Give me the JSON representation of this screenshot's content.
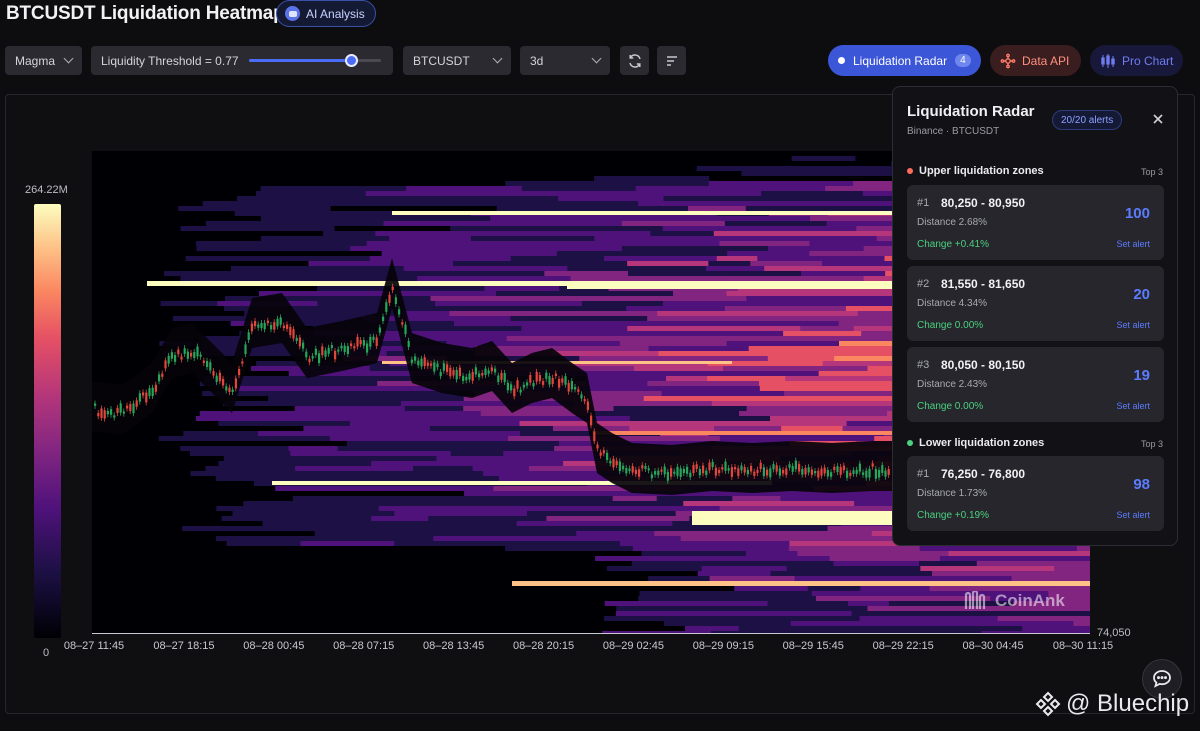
{
  "header": {
    "title": "BTCUSDT Liquidation Heatmap",
    "ai_label": "AI Analysis"
  },
  "toolbar": {
    "palette": "Magma",
    "threshold_label": "Liquidity Threshold = 0.77",
    "threshold_value": 0.77,
    "symbol": "BTCUSDT",
    "timeframe": "3d",
    "refresh_icon": "refresh-icon",
    "sort_icon": "sort-lines-icon"
  },
  "actions": {
    "radar_label": "Liquidation Radar",
    "radar_count": "4",
    "api_label": "Data API",
    "pro_label": "Pro Chart"
  },
  "heatmap": {
    "colorbar_max": "264.22M",
    "colorbar_min": "0",
    "price_low": "74,050",
    "x_labels": [
      "08–27 11:45",
      "08–27 18:15",
      "08–28 00:45",
      "08–28 07:15",
      "08–28 13:45",
      "08–28 20:15",
      "08–29 02:45",
      "08–29 09:15",
      "08–29 15:45",
      "08–29 22:15",
      "08–30 04:45",
      "08–30 11:15"
    ],
    "watermark": "CoinAnk",
    "palette_colors": [
      "#000004",
      "#4f127b",
      "#b5367a",
      "#fb8761",
      "#fcfdbf"
    ]
  },
  "radar": {
    "title": "Liquidation Radar",
    "subtitle": "Binance · BTCUSDT",
    "alerts": "20/20 alerts",
    "upper_title": "Upper liquidation zones",
    "upper_top": "Top 3",
    "upper": [
      {
        "rank": "#1",
        "range": "80,250 - 80,950",
        "distance": "Distance 2.68%",
        "change": "Change +0.41%",
        "score": "100",
        "set_alert": "Set alert"
      },
      {
        "rank": "#2",
        "range": "81,550 - 81,650",
        "distance": "Distance 4.34%",
        "change": "Change 0.00%",
        "score": "20",
        "set_alert": "Set alert"
      },
      {
        "rank": "#3",
        "range": "80,050 - 80,150",
        "distance": "Distance 2.43%",
        "change": "Change 0.00%",
        "score": "19",
        "set_alert": "Set alert"
      }
    ],
    "lower_title": "Lower liquidation zones",
    "lower_top": "Top 3",
    "lower": [
      {
        "rank": "#1",
        "range": "76,250 - 76,800",
        "distance": "Distance 1.73%",
        "change": "Change +0.19%",
        "score": "98",
        "set_alert": "Set alert"
      }
    ],
    "upper_dot_color": "#ff6b5a",
    "lower_dot_color": "#4bd17f"
  },
  "footer": {
    "brand": "@ Bluechip"
  }
}
